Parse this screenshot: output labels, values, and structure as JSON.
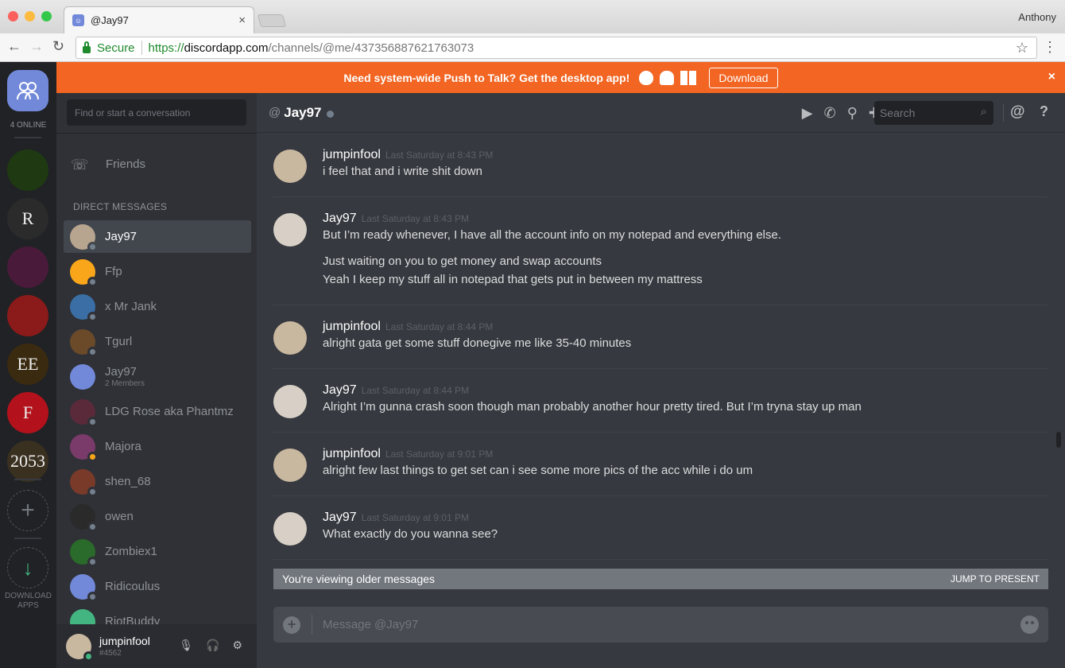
{
  "browser": {
    "tab_title": "@Jay97",
    "tab_close": "×",
    "profile": "Anthony",
    "secure": "Secure",
    "url_scheme": "https://",
    "url_host": "discordapp.com",
    "url_path": "/channels/@me/437356887621763073"
  },
  "guilds": {
    "online": "4 ONLINE",
    "items": [
      {
        "label": "",
        "bg": "#1f3a12"
      },
      {
        "label": "R",
        "bg": "#2b2b2b"
      },
      {
        "label": "",
        "bg": "#4a1a3a"
      },
      {
        "label": "",
        "bg": "#8b1a1a"
      },
      {
        "label": "EE",
        "bg": "#3a2a10"
      },
      {
        "label": "F",
        "bg": "#b3121c"
      },
      {
        "label": "2053",
        "bg": "#3a3020"
      }
    ],
    "add": "+",
    "download": "↓",
    "download_label": "DOWNLOAD APPS"
  },
  "banner": {
    "text": "Need system-wide Push to Talk? Get the desktop app!",
    "download": "Download",
    "close": "×"
  },
  "dm": {
    "search_placeholder": "Find or start a conversation",
    "friends": "Friends",
    "header": "DIRECT MESSAGES",
    "items": [
      {
        "name": "Jay97",
        "sub": "",
        "color": "#b8a58f",
        "status": "#747f8d",
        "selected": true
      },
      {
        "name": "Ffp",
        "sub": "",
        "color": "#faa61a",
        "status": "#747f8d",
        "selected": false
      },
      {
        "name": "x Mr Jank",
        "sub": "",
        "color": "#3a6ea5",
        "status": "#747f8d",
        "selected": false
      },
      {
        "name": "Tgurl",
        "sub": "",
        "color": "#6b4a2a",
        "status": "#747f8d",
        "selected": false
      },
      {
        "name": "Jay97",
        "sub": "2 Members",
        "color": "#7289da",
        "status": "",
        "selected": false
      },
      {
        "name": "LDG Rose aka Phantmz",
        "sub": "",
        "color": "#5a2a3a",
        "status": "#747f8d",
        "selected": false
      },
      {
        "name": "Majora",
        "sub": "",
        "color": "#7a3a6a",
        "status": "#faa61a",
        "selected": false
      },
      {
        "name": "shen_68",
        "sub": "",
        "color": "#7a3a2a",
        "status": "#747f8d",
        "selected": false
      },
      {
        "name": "owen",
        "sub": "",
        "color": "#2a2a2a",
        "status": "#747f8d",
        "selected": false
      },
      {
        "name": "Zombiex1",
        "sub": "",
        "color": "#2a6a2a",
        "status": "#747f8d",
        "selected": false
      },
      {
        "name": "Ridicoulus",
        "sub": "",
        "color": "#7289da",
        "status": "#747f8d",
        "selected": false
      },
      {
        "name": "RiotBuddy",
        "sub": "",
        "color": "#43b581",
        "status": "#747f8d",
        "selected": false
      }
    ]
  },
  "user": {
    "name": "jumpinfool",
    "tag": "#4562"
  },
  "channel": {
    "at": "@",
    "name": "Jay97",
    "search": "Search",
    "at_icon": "@",
    "help": "?"
  },
  "messages": [
    {
      "author": "jumpinfool",
      "time": "Last Saturday at 8:43 PM",
      "avatar": "#c9b8a0",
      "lines": [
        "i feel that and i write shit down"
      ]
    },
    {
      "author": "Jay97",
      "time": "Last Saturday at 8:43 PM",
      "avatar": "#d8d0c6",
      "lines": [
        "But I’m ready whenever, I have all the account info on my notepad and everything else.",
        "Just waiting on you to get money and swap accounts",
        "Yeah I keep my stuff all in notepad that gets put in between my mattress"
      ]
    },
    {
      "author": "jumpinfool",
      "time": "Last Saturday at 8:44 PM",
      "avatar": "#c9b8a0",
      "lines": [
        "alright gata get some stuff donegive me like 35-40 minutes"
      ]
    },
    {
      "author": "Jay97",
      "time": "Last Saturday at 8:44 PM",
      "avatar": "#d8d0c6",
      "lines": [
        "Alright I’m gunna crash soon though man probably another hour pretty tired. But I’m tryna stay up man"
      ]
    },
    {
      "author": "jumpinfool",
      "time": "Last Saturday at 9:01 PM",
      "avatar": "#c9b8a0",
      "lines": [
        "alright few last things to get set can i see some more pics of the acc while i do um"
      ]
    },
    {
      "author": "Jay97",
      "time": "Last Saturday at 9:01 PM",
      "avatar": "#d8d0c6",
      "lines": [
        "What exactly do you wanna see?"
      ]
    }
  ],
  "older": {
    "text": "You're viewing older messages",
    "jump": "JUMP TO PRESENT"
  },
  "composer": {
    "plus": "+",
    "placeholder": "Message @Jay97"
  }
}
